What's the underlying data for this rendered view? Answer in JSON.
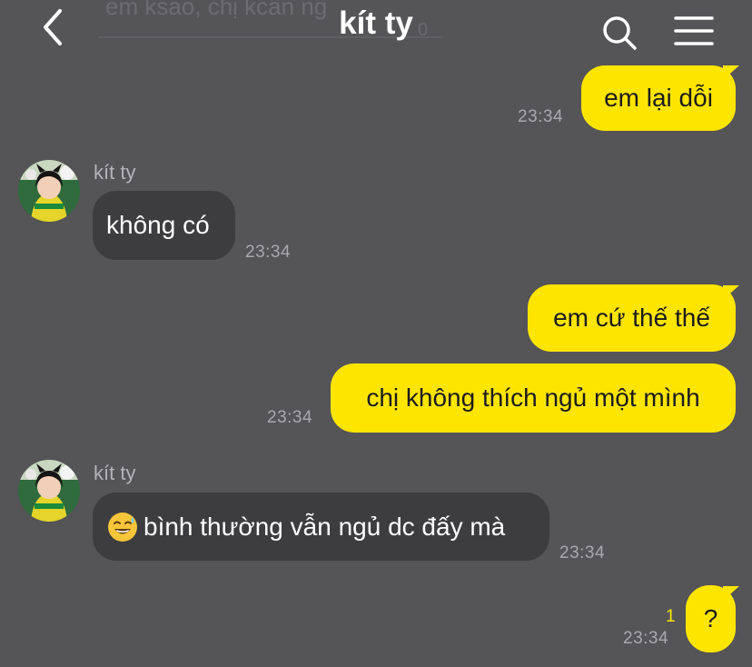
{
  "header": {
    "title": "kít ty",
    "ghost_text": "em ksao, chị kcần ng",
    "ghost_time": "0"
  },
  "messages": [
    {
      "id": "m1",
      "direction": "out",
      "text": "em lại dỗi",
      "time": "23:34"
    },
    {
      "id": "m2",
      "direction": "in",
      "sender": "kít ty",
      "text": "không có",
      "time": "23:34"
    },
    {
      "id": "m3",
      "direction": "out",
      "text": "em cứ thế thế"
    },
    {
      "id": "m4",
      "direction": "out",
      "text": "chị không thích ngủ một mình",
      "time": "23:34"
    },
    {
      "id": "m5",
      "direction": "in",
      "sender": "kít ty",
      "emoji": "sweat-smile-emoji",
      "text": "bình thường vẫn ngủ dc đấy mà",
      "time": "23:34"
    },
    {
      "id": "m6",
      "direction": "out",
      "text": "?",
      "time": "23:34",
      "unread_count": "1"
    }
  ],
  "icons": {
    "back": "chevron-left-icon",
    "search": "search-icon",
    "menu": "hamburger-menu-icon"
  },
  "colors": {
    "background": "#555457",
    "outgoing_bubble": "#fee500",
    "incoming_bubble": "#3d3c3f",
    "unread": "#fee500"
  }
}
